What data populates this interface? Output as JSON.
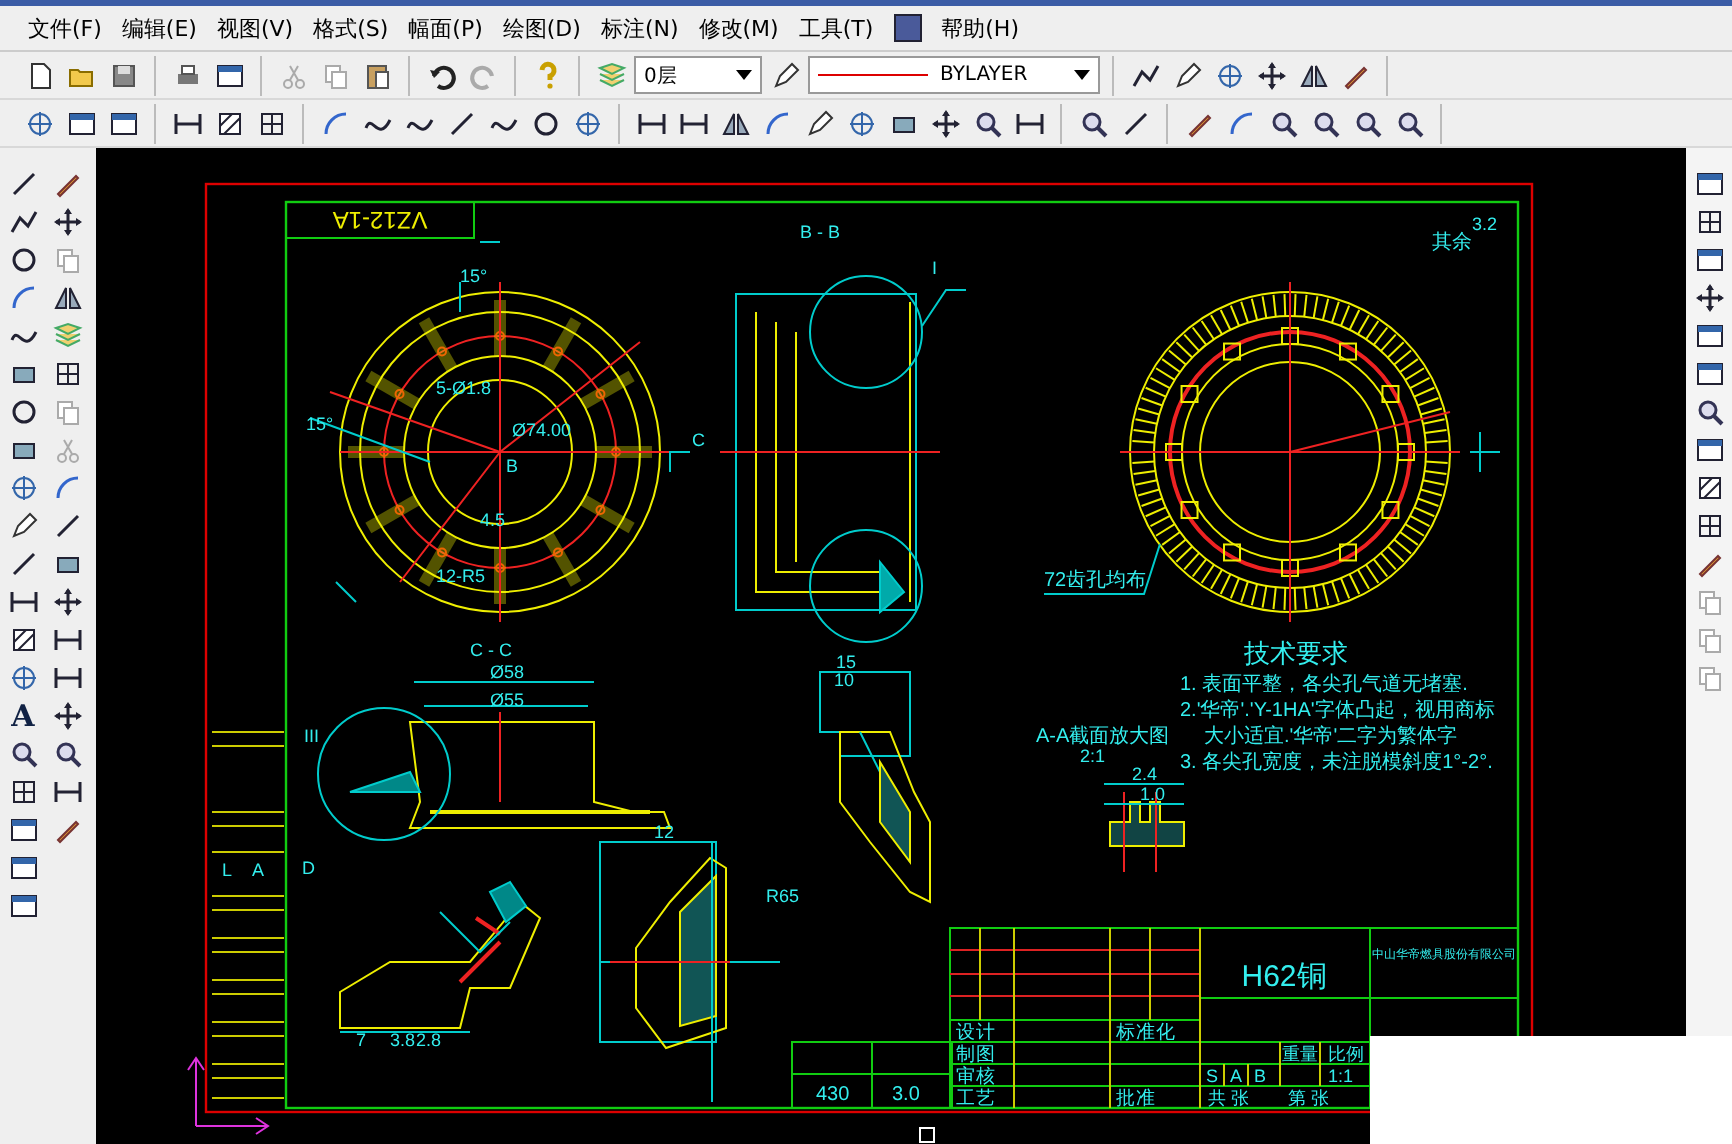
{
  "menu_bar": {
    "items": [
      {
        "label": "文件(F)"
      },
      {
        "label": "编辑(E)"
      },
      {
        "label": "视图(V)"
      },
      {
        "label": "格式(S)"
      },
      {
        "label": "幅面(P)"
      },
      {
        "label": "绘图(D)"
      },
      {
        "label": "标注(N)"
      },
      {
        "label": "修改(M)"
      },
      {
        "label": "工具(T)"
      },
      {
        "label": "帮助(H)"
      }
    ]
  },
  "toolbar": {
    "layer_dropdown": {
      "value": "0层"
    },
    "linetype_dropdown": {
      "value": "BYLAYER"
    }
  },
  "left_toolbar": {
    "text_tool": "A"
  },
  "drawing": {
    "title_tag": "VZ12-1A",
    "labels": [
      "B - B",
      "I",
      "15°",
      "5-Ø1.8",
      "Ø74.00",
      "B",
      "15°",
      "C",
      "4.5",
      "12-R5",
      "C - C",
      "Ø58",
      "Ø55",
      "III",
      "15",
      "10",
      "D",
      "12",
      "R65",
      "72齿孔均布",
      "A-A截面放大图",
      "2:1",
      "2.4",
      "1.0",
      "3.2",
      "其余",
      "7",
      "3.8",
      "2.8",
      "L",
      "A"
    ],
    "tech_requirements": {
      "title": "技术要求",
      "lines": [
        "1. 表面平整，各尖孔气道无堵塞.",
        "2.'华帝'.'Y-1HA'字体凸起，视用商标",
        "大小适宜.'华帝'二字为繁体字",
        "3. 各尖孔宽度，未注脱模斜度1°-2°."
      ]
    },
    "spec_table": {
      "values": [
        "430",
        "3.0"
      ]
    },
    "title_block": {
      "material": "H62铜",
      "company": "中山华帝燃具股份有限公司",
      "row_labels": [
        "设计",
        "制图",
        "审核",
        "工艺"
      ],
      "mid_labels": [
        "标准化",
        "批准"
      ],
      "headers": [
        "重量",
        "比例"
      ],
      "stage_marks": [
        "S",
        "A",
        "B"
      ],
      "scale": "1:1",
      "sheet_labels": [
        "共 张",
        "第 张"
      ]
    }
  }
}
